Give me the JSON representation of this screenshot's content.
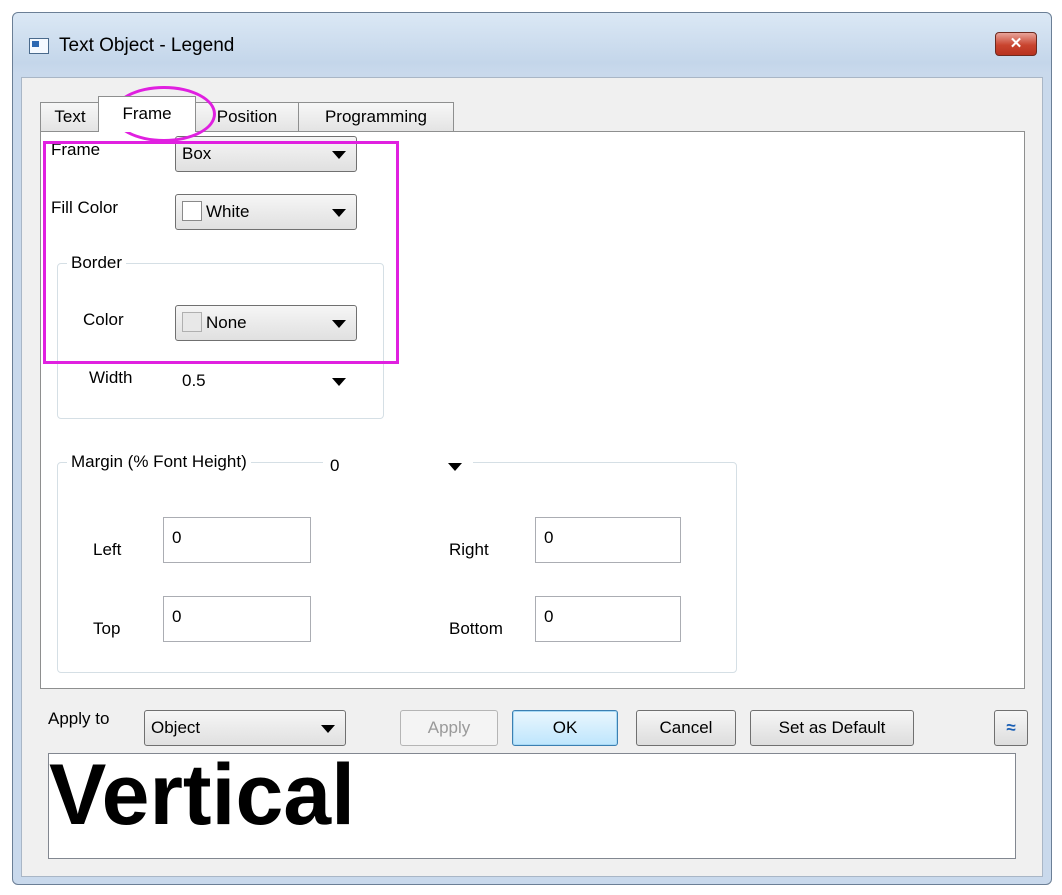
{
  "window": {
    "title": "Text Object - Legend",
    "close_symbol": "✕"
  },
  "tabs": [
    {
      "label": "Text",
      "active": false
    },
    {
      "label": "Frame",
      "active": true
    },
    {
      "label": "Position",
      "active": false
    },
    {
      "label": "Programming",
      "active": false
    }
  ],
  "frame_tab": {
    "frame_label": "Frame",
    "frame_value": "Box",
    "fill_color_label": "Fill Color",
    "fill_color_value": "White",
    "border": {
      "title": "Border",
      "color_label": "Color",
      "color_value": "None",
      "width_label": "Width",
      "width_value": "0.5"
    },
    "margin": {
      "title": "Margin (% Font Height)",
      "value": "0",
      "left_label": "Left",
      "left_value": "0",
      "right_label": "Right",
      "right_value": "0",
      "top_label": "Top",
      "top_value": "0",
      "bottom_label": "Bottom",
      "bottom_value": "0"
    }
  },
  "bottom_bar": {
    "apply_to_label": "Apply to",
    "apply_to_value": "Object",
    "apply_button": "Apply",
    "ok_button": "OK",
    "cancel_button": "Cancel",
    "set_default_button": "Set as Default",
    "collapse_symbol": "≈"
  },
  "preview": {
    "text": "Vertical"
  },
  "colors": {
    "highlight": "#e020e0",
    "close_button": "#c9442f",
    "default_button": "#3c7fb1"
  }
}
